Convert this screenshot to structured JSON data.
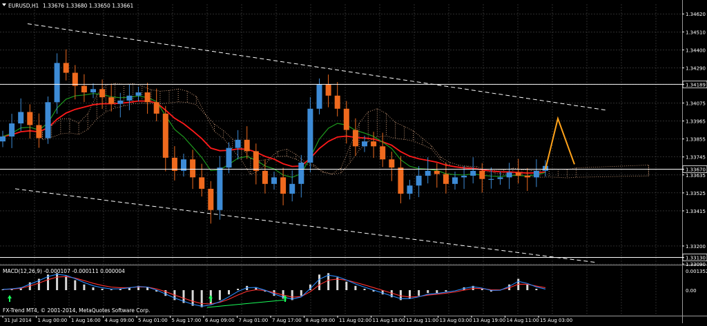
{
  "chart_data": [
    {
      "type": "candlestick",
      "title": "EURUSD,H1",
      "quote": "1.33676 1.33680 1.33650 1.33661",
      "symbol": "EURUSD",
      "timeframe": "H1",
      "y_ticks": [
        "1.34620",
        "1.34510",
        "1.34400",
        "1.34290",
        "1.34189",
        "1.34075",
        "1.33965",
        "1.33855",
        "1.33745",
        "1.33670",
        "1.33635",
        "1.33525",
        "1.33415",
        "1.33200",
        "1.33130",
        "1.33090"
      ],
      "ylim": [
        1.3309,
        1.3468
      ],
      "price_lines": [
        {
          "value": 1.34189,
          "label": "1.34189"
        },
        {
          "value": 1.3367,
          "label": "1.33670"
        },
        {
          "value": 1.3313,
          "label": "1.33130"
        }
      ],
      "x_labels": [
        "31 Jul 2014",
        "1 Aug 00:00",
        "1 Aug 16:00",
        "4 Aug 09:00",
        "5 Aug 01:00",
        "5 Aug 17:00",
        "6 Aug 09:00",
        "7 Aug 01:00",
        "7 Aug 17:00",
        "8 Aug 09:00",
        "11 Aug 02:00",
        "11 Aug 18:00",
        "12 Aug 11:00",
        "13 Aug 03:00",
        "13 Aug 19:00",
        "14 Aug 11:00",
        "15 Aug 03:00"
      ],
      "grid": true,
      "series": [
        {
          "name": "price",
          "values": [
            1.3387,
            1.3395,
            1.3402,
            1.3394,
            1.3386,
            1.3408,
            1.3432,
            1.3426,
            1.3418,
            1.3414,
            1.3416,
            1.3411,
            1.3407,
            1.3409,
            1.3412,
            1.3414,
            1.3408,
            1.3401,
            1.3374,
            1.3366,
            1.3373,
            1.3362,
            1.3355,
            1.3342,
            1.3368,
            1.338,
            1.3385,
            1.3378,
            1.3366,
            1.3358,
            1.3362,
            1.3352,
            1.3358,
            1.3371,
            1.3404,
            1.3419,
            1.3412,
            1.3404,
            1.3391,
            1.3381,
            1.3384,
            1.3381,
            1.3373,
            1.3368,
            1.3352,
            1.3357,
            1.3363,
            1.3366,
            1.3364,
            1.3358,
            1.3362,
            1.3363,
            1.3366,
            1.3361,
            1.3361,
            1.3362,
            1.3365,
            1.3363,
            1.3362,
            1.3366,
            1.3369
          ]
        },
        {
          "name": "forecast",
          "values": [
            1.3367,
            1.3398,
            1.337
          ]
        }
      ]
    },
    {
      "type": "histogram",
      "title": "MACD(12,26,9) -0.000107 -0.000111 0.000004",
      "y_ticks": [
        "0.001352",
        "0.00"
      ],
      "ylim": [
        -0.0017,
        0.0017
      ],
      "series": [
        {
          "name": "histogram",
          "values": [
            5e-05,
            0.00012,
            0.0002,
            0.00055,
            0.0008,
            0.0011,
            0.0012,
            0.001,
            0.0007,
            0.0004,
            0.0002,
            0.0001,
            5e-05,
            0.0001,
            0.0002,
            0.0003,
            0.0002,
            -0.0001,
            -0.0004,
            -0.0007,
            -0.0009,
            -0.0011,
            -0.0012,
            -0.001,
            -0.0007,
            -0.0003,
            0.0001,
            0.0003,
            0.0002,
            -0.0001,
            -0.0004,
            -0.0006,
            -0.0007,
            -0.0004,
            0.0004,
            0.0011,
            0.0012,
            0.0009,
            0.0006,
            0.0003,
            0.0001,
            -0.0001,
            -0.0003,
            -0.0005,
            -0.0007,
            -0.0006,
            -0.0004,
            -0.0002,
            -0.0002,
            -0.0001,
            0.0,
            0.0002,
            0.0003,
            0.0001,
            -0.0001,
            0.0,
            0.0004,
            0.0008,
            0.0004,
            0.0001,
            0.0
          ]
        }
      ]
    }
  ],
  "footer": {
    "copyright": "FX-Trend MT4, © 2001-2014, MetaQuotes Software Corp."
  },
  "colors": {
    "background": "#000000",
    "grid": "#4a4a4a",
    "bull": "#3d8bd6",
    "bear": "#ef6a1e",
    "ma_red": "#ff1a1a",
    "ma_green": "#1e9a1e",
    "cloud": "#e6b08a",
    "forecast": "#ffa21a",
    "macd_signal": "#ff3333",
    "macd_main": "#2b8cff",
    "arrow": "#19ff5a"
  }
}
